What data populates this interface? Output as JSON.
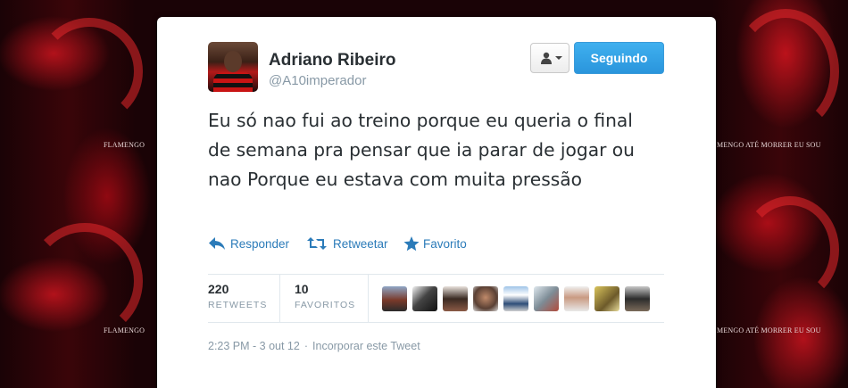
{
  "background": {
    "watermark_left": "FLAMENGO",
    "watermark_right": "MENGO ATÉ MORRER EU SOU",
    "accent_color": "#c8141e"
  },
  "tweet": {
    "author_name": "Adriano Ribeiro",
    "author_handle": "@A10imperador",
    "avatar_icon": "avatar",
    "follow_label": "Seguindo",
    "follow_color": "#2a95dc",
    "user_menu_icon": "person-icon",
    "text": "Eu só nao fui ao treino porque eu queria o final de semana pra pensar que ia parar de jogar ou nao Porque eu estava com muita pressão",
    "actions": {
      "reply": "Responder",
      "retweet": "Retweetar",
      "favorite": "Favorito"
    },
    "stats": {
      "retweets_count": "220",
      "retweets_label": "RETWEETS",
      "favorites_count": "10",
      "favorites_label": "FAVORITOS"
    },
    "favoriters_count_shown": 9,
    "timestamp": "2:23 PM - 3 out 12",
    "embed_label": "Incorporar este Tweet"
  }
}
